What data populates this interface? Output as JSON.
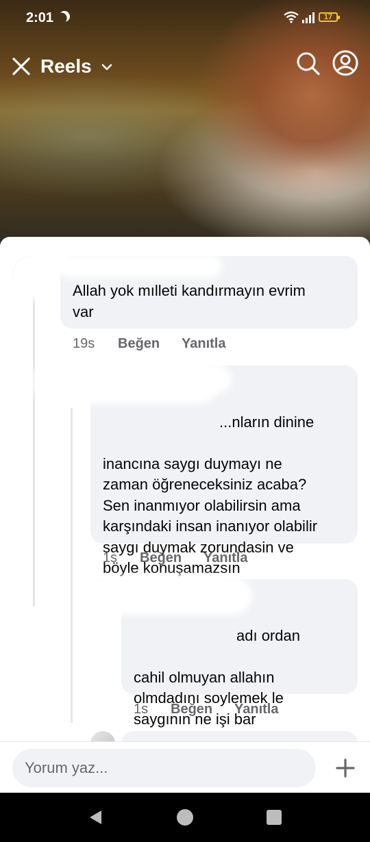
{
  "status_bar": {
    "time": "2:01",
    "battery": "17",
    "icons": [
      "moon-icon",
      "wifi-icon",
      "signal-icon",
      "battery-icon"
    ]
  },
  "header": {
    "title": "Reels",
    "icons": [
      "close-icon",
      "chevron-down-icon",
      "search-icon",
      "profile-icon"
    ]
  },
  "comments": [
    {
      "text": "Allah yok mılleti kandırmayın  evrim\nvar",
      "time": "19s",
      "like_label": "Beğen",
      "reply_label": "Yanıtla"
    },
    {
      "text_line1": "...nların dinine",
      "text_rest": "inancına saygı duymayı ne\nzaman öğreneceksiniz acaba?\nSen inanmıyor olabilirsin ama\nkarşındaki insan inanıyor olabilir\nsaygı duymak zorundasin ve\nböyle konuşamazsın",
      "time": "1s",
      "like_label": "Beğen",
      "reply_label": "Yanıtla"
    },
    {
      "text_line1": "adı ordan",
      "text_rest": "cahil olmuyan allahın\nolmdadını soylemek  le\nsaygının ne işi bar",
      "time": "1s",
      "like_label": "Beğen",
      "reply_label": "Yanıtla"
    }
  ],
  "composer": {
    "placeholder": "Yorum yaz..."
  },
  "colors": {
    "bubble": "#f0f2f5",
    "meta_text": "#65676b",
    "battery": "#f3c13a",
    "link": "#1877f2"
  }
}
